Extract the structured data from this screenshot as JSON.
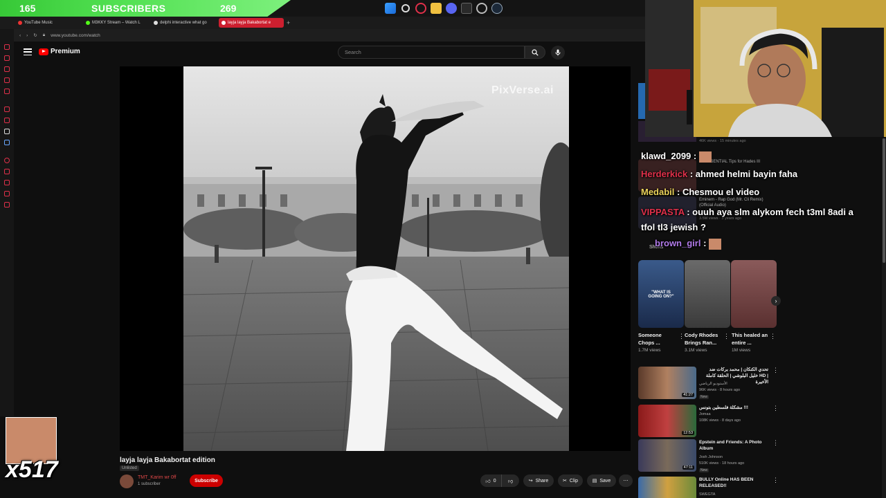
{
  "overlay": {
    "subscriber_count": "165",
    "subscriber_label": "SUBSCRIBERS",
    "subscriber_goal": "269",
    "emote_count": "x517"
  },
  "browser": {
    "tabs": [
      {
        "label": "YouTube Music",
        "active": false
      },
      {
        "label": "M3KKY Stream – Watch L",
        "active": false
      },
      {
        "label": "delphi interactive what go",
        "active": false
      },
      {
        "label": "layja layja Bakabortat e",
        "active": true
      }
    ],
    "url": "www.youtube.com/watch"
  },
  "header": {
    "logo_text": "Premium",
    "search_placeholder": "Search"
  },
  "video": {
    "watermark": "PixVerse.ai",
    "title": "layja layja Bakabortat edition",
    "visibility": "Unlisted",
    "channel_name": "TMT_Karim wr 0ff",
    "channel_subs": "1 subscriber",
    "subscribe_label": "Subscribe",
    "like_count": "0",
    "share_label": "Share",
    "clip_label": "Clip",
    "save_label": "Save"
  },
  "chat": [
    {
      "user": "klawd_2099",
      "text": ":",
      "color": "#ffffff"
    },
    {
      "user": "Herderkick",
      "text": ": ahmed helmi bayin faha",
      "color": "#e0304a"
    },
    {
      "user": "Medabil",
      "text": ": Chesmou el video",
      "color": "#e9d25a"
    },
    {
      "user": "VIPPASTA",
      "text": ": ouuh aya slm alykom fech t3ml 8adi a tfol tl3 jewish ?",
      "color": "#e0304a"
    },
    {
      "user": "brown_girl",
      "text": ":",
      "color": "#b07ae8"
    }
  ],
  "sidebar_bg_text": {
    "item1_title": "14 ESSENTIAL Tips for Hades III",
    "item2_title": "Eminem - Rap God (Mr. Cli Remix) (Official Audio)",
    "item2_meta": "3.5M views · 3 years ago",
    "item0_meta": "46K views · 15 minutes ago",
    "new_badge": "New",
    "shorts_label": "Shorts"
  },
  "shorts": [
    {
      "title": "Someone Chops ...",
      "views": "1.7M views",
      "caption": "\"WHAT IS GOING ON?\""
    },
    {
      "title": "Cody Rhodes Brings Ran...",
      "views": "3.1M views"
    },
    {
      "title": "This healed an entire ...",
      "views": "1M views"
    }
  ],
  "recommended": [
    {
      "title": "تحدي الكنكان | محمد بركات ضد خليل البلوشي | الحلقة كاملة HD | الأخيرة",
      "channel": "الأستوديو الرياضي",
      "meta": "96K views · 8 hours ago",
      "badge": "New",
      "duration": "41:27"
    },
    {
      "title": "مشكلة فلسطين بتونس !!!",
      "channel": "Jomaa",
      "meta": "108K views · 8 days ago",
      "badge": "",
      "duration": "12:53"
    },
    {
      "title": "Epstein and Friends: A Photo Album",
      "channel": "Josh Johnson",
      "meta": "510K views · 18 hours ago",
      "badge": "New",
      "duration": "47:11"
    },
    {
      "title": "BULLY Online HAS BEEN RELEASED!!",
      "channel": "SWEGTA",
      "meta": "",
      "badge": "",
      "duration": ""
    }
  ],
  "colors": {
    "accent_red": "#cc0000",
    "sub_green": "#51e051",
    "tab_active": "#cc1f2f"
  }
}
